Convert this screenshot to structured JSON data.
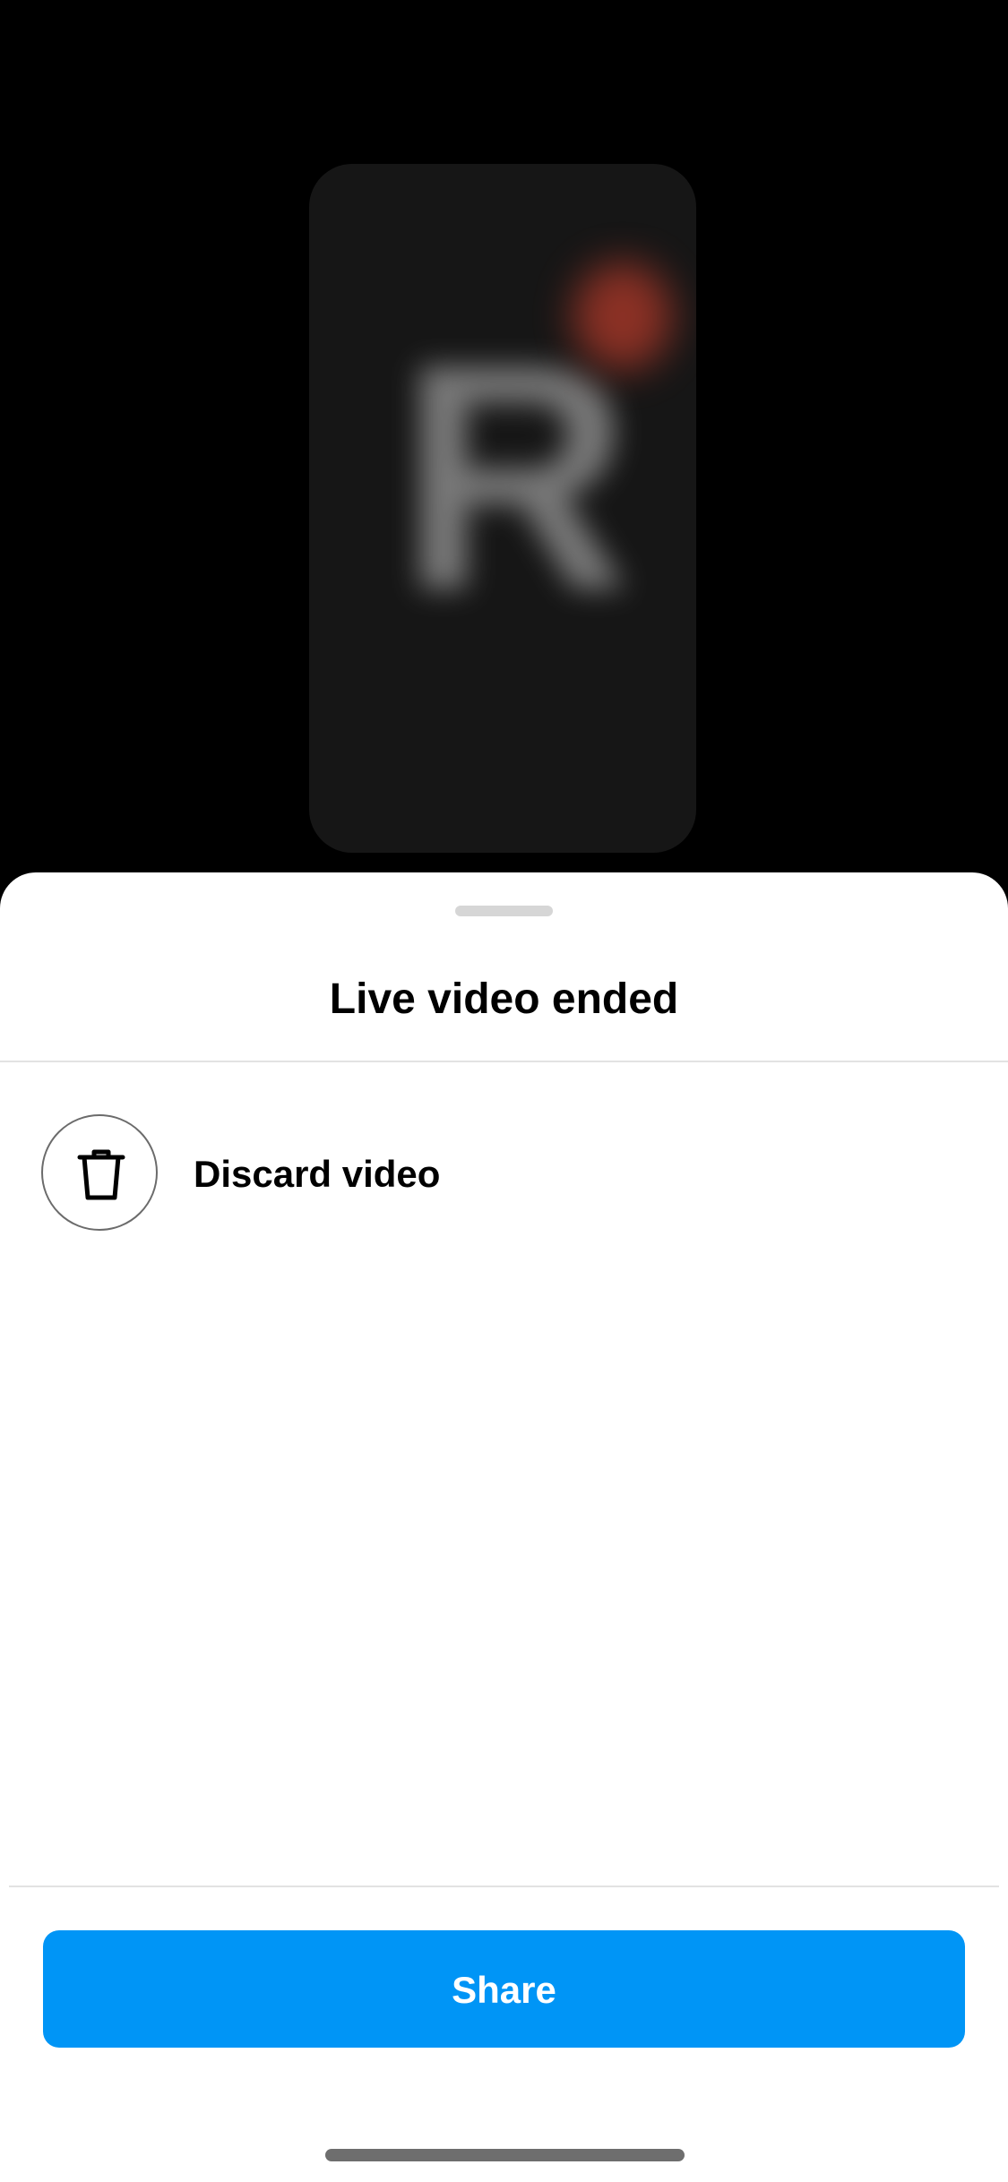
{
  "preview": {
    "glyph": "R",
    "background_color": "#161616",
    "glyph_color": "#8a8a8a",
    "dot_color": "#b33a2a"
  },
  "sheet": {
    "title": "Live video ended",
    "options": [
      {
        "label": "Discard video",
        "icon": "trash-icon"
      }
    ],
    "primary_action": {
      "label": "Share",
      "color": "#0095f6"
    }
  }
}
